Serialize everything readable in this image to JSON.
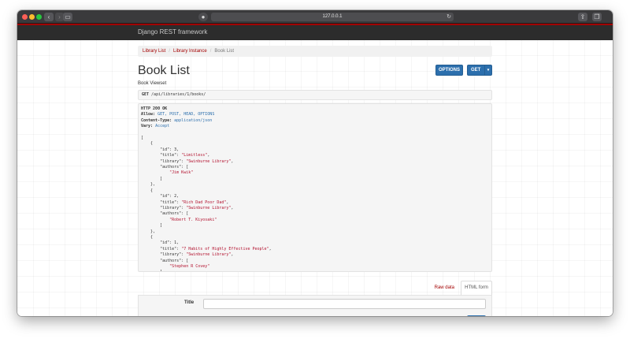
{
  "browser": {
    "url": "127.0.0.1",
    "back_icon": "chevron-left-icon",
    "sidebar_icon": "sidebar-icon",
    "shield_icon": "shield-icon",
    "reload_icon": "reload-icon",
    "share_icon": "share-icon",
    "tabs_icon": "tabs-icon"
  },
  "navbar": {
    "brand": "Django REST framework",
    "accent_color": "#a30000"
  },
  "breadcrumb": [
    "Library List",
    "Library Instance",
    "Book List"
  ],
  "page": {
    "title": "Book List",
    "subtitle": "Book Viewset",
    "options_button": "OPTIONS",
    "get_button": "GET",
    "request_method": "GET",
    "request_path": "/api/libraries/1/books/"
  },
  "response": {
    "status": "HTTP 200 OK",
    "headers": [
      {
        "key": "Allow:",
        "value": "GET, POST, HEAD, OPTIONS"
      },
      {
        "key": "Content-Type:",
        "value": "application/json"
      },
      {
        "key": "Vary:",
        "value": "Accept"
      }
    ],
    "books": [
      {
        "id": 3,
        "title": "Limitless",
        "library": "Swinburne Library",
        "authors": [
          "Jim Kwik"
        ]
      },
      {
        "id": 2,
        "title": "Rich Dad Poor Dad",
        "library": "Swinburne Library",
        "authors": [
          "Robert T. Kiyosaki"
        ]
      },
      {
        "id": 1,
        "title": "7 Habits of Highly Effective People",
        "library": "Swinburne Library",
        "authors": [
          "Stephen R Covey"
        ]
      }
    ]
  },
  "form_tabs": {
    "raw": "Raw data",
    "html": "HTML form"
  },
  "form": {
    "title_label": "Title",
    "title_value": ""
  }
}
